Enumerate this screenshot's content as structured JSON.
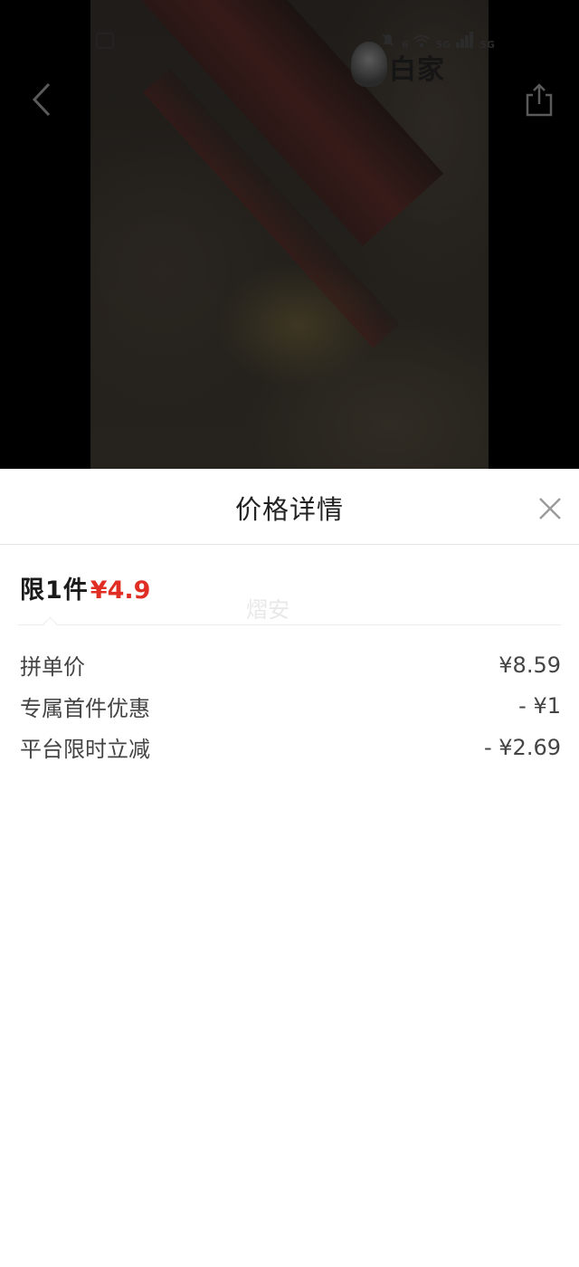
{
  "sheet": {
    "title": "价格详情",
    "limit_label": "限1件",
    "limit_price": "¥4.9",
    "faint_watermark": "熠安",
    "rows": [
      {
        "label": "拼单价",
        "amount": "¥8.59"
      },
      {
        "label": "专属首件优惠",
        "amount": "- ¥1"
      },
      {
        "label": "平台限时立减",
        "amount": "- ¥2.69"
      }
    ]
  },
  "video": {
    "watermark": "白家"
  },
  "status_bar": {
    "network_1": "5G",
    "network_2": "5G",
    "wifi_num": "6"
  },
  "icons": {
    "back": "chevron-left-icon",
    "share": "share-icon",
    "close": "close-icon"
  },
  "colors": {
    "price_red": "#e02e24",
    "dim_overlay": "#000000"
  }
}
